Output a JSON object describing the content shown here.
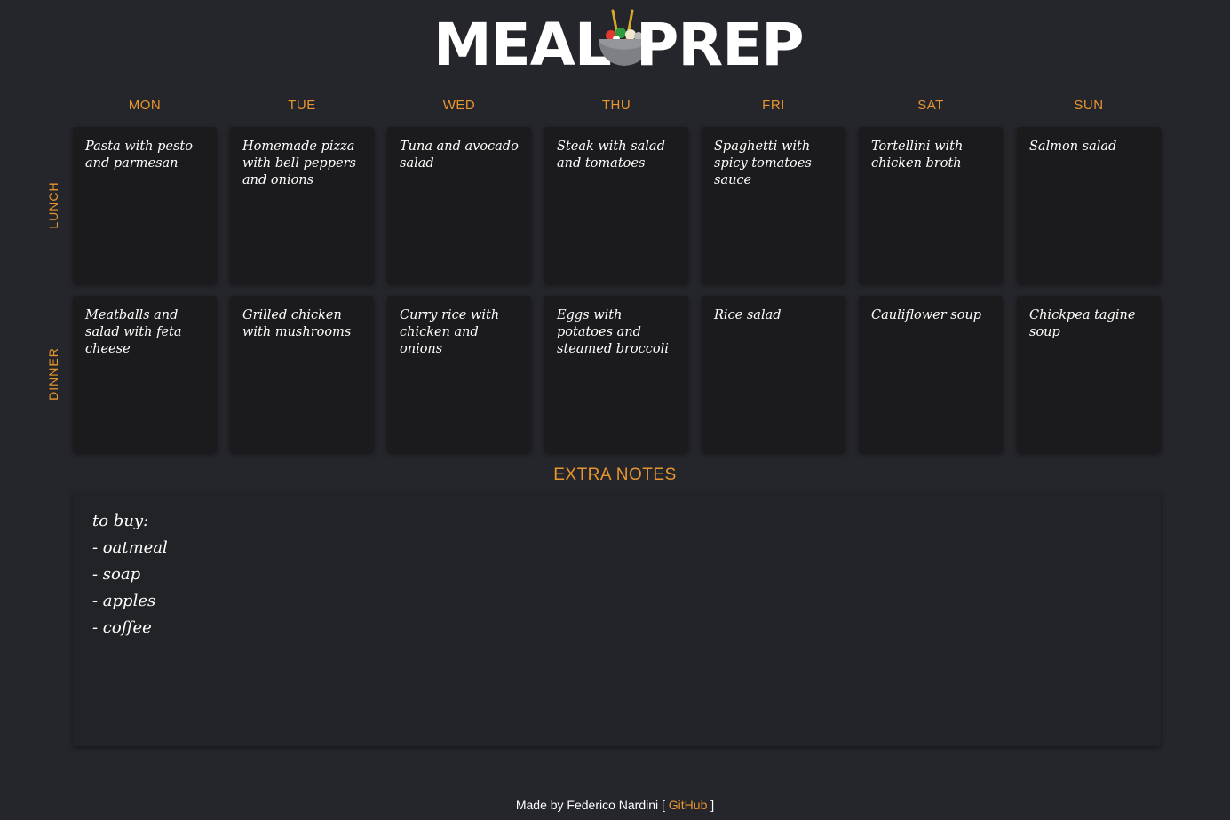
{
  "logo": {
    "left_text": "MEAL",
    "right_text": "PREP"
  },
  "days": [
    "MON",
    "TUE",
    "WED",
    "THU",
    "FRI",
    "SAT",
    "SUN"
  ],
  "rows": {
    "lunch_label": "LUNCH",
    "dinner_label": "DINNER"
  },
  "lunch": [
    "Pasta with pesto and parmesan",
    "Homemade pizza with bell peppers and onions",
    "Tuna and avocado salad",
    "Steak with salad and tomatoes",
    "Spaghetti with spicy tomatoes sauce",
    "Tortellini with chicken broth",
    "Salmon salad"
  ],
  "dinner": [
    "Meatballs and salad with feta cheese",
    "Grilled chicken with mushrooms",
    "Curry rice with chicken and onions",
    "Eggs with potatoes and steamed broccoli",
    "Rice salad",
    "Cauliflower soup",
    "Chickpea tagine soup"
  ],
  "notes": {
    "title": "EXTRA NOTES",
    "lines": [
      "to buy:",
      "- oatmeal",
      "- soap",
      "- apples",
      "- coffee"
    ]
  },
  "footer": {
    "prefix": "Made by Federico Nardini [",
    "link_label": "GitHub",
    "suffix": "]"
  },
  "colors": {
    "background": "#25262b",
    "card": "#1b1b1d",
    "accent": "#e8962e",
    "text": "#ffffff"
  }
}
